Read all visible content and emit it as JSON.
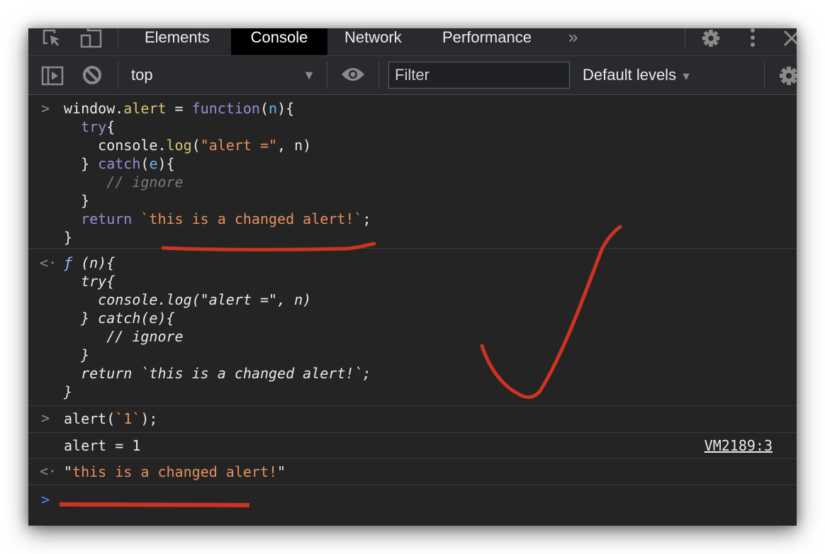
{
  "tabbar": {
    "tabs": [
      {
        "label": "Elements",
        "active": false
      },
      {
        "label": "Console",
        "active": true
      },
      {
        "label": "Network",
        "active": false
      },
      {
        "label": "Performance",
        "active": false
      }
    ],
    "more_tabs": "»",
    "icons": [
      "inspect-element-icon",
      "device-toolbar-icon",
      "settings-icon",
      "more-options-icon",
      "close-icon"
    ]
  },
  "toolbar": {
    "context": "top",
    "context_arrow": "▼",
    "filter_placeholder": "Filter",
    "filter_value": "",
    "levels_label": "Default levels",
    "levels_arrow": "▼"
  },
  "console": {
    "input1": {
      "prompt": ">",
      "lines": [
        [
          [
            "",
            "window."
          ],
          [
            "prop",
            "alert"
          ],
          [
            "",
            " = "
          ],
          [
            "kw",
            "function"
          ],
          [
            "",
            "("
          ],
          [
            "param",
            "n"
          ],
          [
            "",
            "){"
          ]
        ],
        [
          [
            "",
            "  "
          ],
          [
            "kw",
            "try"
          ],
          [
            "",
            "{"
          ]
        ],
        [
          [
            "",
            "    console."
          ],
          [
            "prop",
            "log"
          ],
          [
            "",
            "("
          ],
          [
            "str",
            "\"alert =\""
          ],
          [
            "",
            ", n)"
          ]
        ],
        [
          [
            "",
            "  } "
          ],
          [
            "kw",
            "catch"
          ],
          [
            "",
            "("
          ],
          [
            "param",
            "e"
          ],
          [
            "",
            "){"
          ]
        ],
        [
          [
            "",
            "     "
          ],
          [
            "cmt",
            "// ignore"
          ]
        ],
        [
          [
            "",
            "  }"
          ]
        ],
        [
          [
            "",
            "  "
          ],
          [
            "kw",
            "return"
          ],
          [
            "",
            " "
          ],
          [
            "str",
            "`this is a changed alert!`"
          ],
          [
            "",
            ";"
          ]
        ],
        [
          [
            "",
            "}"
          ]
        ]
      ]
    },
    "result1": {
      "prompt": "<·",
      "lines": [
        [
          [
            "fsym",
            "ƒ"
          ],
          [
            "",
            " (n){"
          ]
        ],
        [
          [
            "",
            "  try{"
          ]
        ],
        [
          [
            "",
            "    console.log(\"alert =\", n)"
          ]
        ],
        [
          [
            "",
            "  } catch(e){"
          ]
        ],
        [
          [
            "",
            "     // ignore"
          ]
        ],
        [
          [
            "",
            "  }"
          ]
        ],
        [
          [
            "",
            "  return `this is a changed alert!`;"
          ]
        ],
        [
          [
            "",
            "}"
          ]
        ]
      ]
    },
    "input2": {
      "prompt": ">",
      "lines": [
        [
          [
            "",
            "alert("
          ],
          [
            "str",
            "`1`"
          ],
          [
            "",
            ");"
          ]
        ]
      ]
    },
    "log1": {
      "text": "alert = 1",
      "source": "VM2189:3"
    },
    "result2": {
      "prompt": "<·",
      "lines": [
        [
          [
            "",
            "\""
          ],
          [
            "str",
            "this is a changed alert!"
          ],
          [
            "",
            "\""
          ]
        ]
      ]
    },
    "active_prompt": ">",
    "input_value": ""
  },
  "colors": {
    "annotation": "#cc3322",
    "prompt_active": "#4c8df6"
  }
}
